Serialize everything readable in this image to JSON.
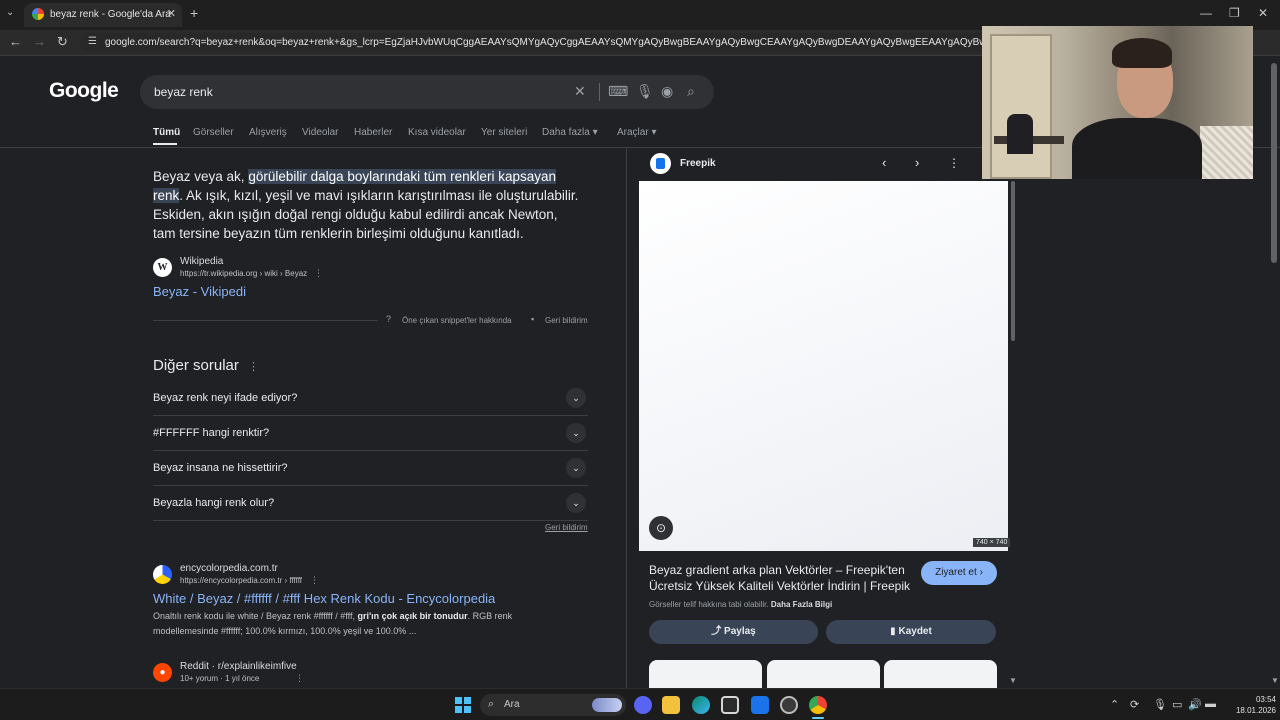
{
  "browser": {
    "tab_title": "beyaz renk - Google'da Ara",
    "new_tab_symbol": "+",
    "url": "google.com/search?q=beyaz+renk&oq=beyaz+renk+&gs_lcrp=EgZjaHJvbWUqCggAEAAYsQMYgAQyCggAEAAYsQMYgAQyBwgBEAAYgAQyBwgCEAAYgAQyBwgDEAAYgAQyBwgEEAAYgAQyBwgFEAAYgAQyBwgGEAA"
  },
  "search": {
    "logo": "Google",
    "query": "beyaz renk"
  },
  "nav": {
    "tabs": [
      "Tümü",
      "Görseller",
      "Alışveriş",
      "Videolar",
      "Haberler",
      "Kısa videolar",
      "Yer siteleri",
      "Daha fazla",
      "Araçlar"
    ]
  },
  "featured_snippet": {
    "text_before": "Beyaz veya ak, ",
    "highlight": "görülebilir dalga boylarındaki tüm renkleri kapsayan renk",
    "text_after": ". Ak ışık, kızıl, yeşil ve mavi ışıkların karıştırılması ile oluşturulabilir. Eskiden, akın ışığın doğal rengi olduğu kabul edilirdi ancak Newton, tam tersine beyazın tüm renklerin birleşimi olduğunu kanıtladı.",
    "source_icon_letter": "W",
    "source_name": "Wikipedia",
    "source_url": "https://tr.wikipedia.org › wiki › Beyaz",
    "link_text": "Beyaz - Vikipedi",
    "about_label": "Öne çıkan snippet'ler hakkında",
    "feedback_label": "Geri bildirim"
  },
  "related_questions": {
    "title": "Diğer sorular",
    "items": [
      "Beyaz renk neyi ifade ediyor?",
      "#FFFFFF hangi renktir?",
      "Beyaz insana ne hissettirir?",
      "Beyazla hangi renk olur?"
    ],
    "feedback_label": "Geri bildirim"
  },
  "results": [
    {
      "site": "encycolorpedia.com.tr",
      "url": "https://encycolorpedia.com.tr › ffffff",
      "title": "White / Beyaz / #ffffff / #fff Hex Renk Kodu - Encycolorpedia",
      "desc_before": "Onaltılı renk kodu ile white / Beyaz renk #ffffff / #fff, ",
      "desc_bold": "gri'ın çok açık bir tonudur",
      "desc_after": ". RGB renk modellemesinde #ffffff; 100.0% kırmızı, 100.0% yeşil ve 100.0% ..."
    },
    {
      "site": "Reddit · r/explainlikeimfive",
      "meta": "10+ yorum · 1 yıl önce"
    }
  ],
  "side_panel": {
    "source": "Freepik",
    "image_size": "740 × 740",
    "title": "Beyaz gradient arka plan Vektörler – Freepik'ten Ücretsiz Yüksek Kaliteli Vektörler İndirin | Freepik",
    "visit_label": "Ziyaret et",
    "copyright_text": "Görseller telif hakkına tabi olabilir.",
    "learn_more": "Daha Fazla Bilgi",
    "share_label": "Paylaş",
    "save_label": "Kaydet"
  },
  "taskbar": {
    "search_label": "Ara",
    "time": "03:54",
    "date": "18.01.2026"
  },
  "colors": {
    "background": "#202124",
    "link": "#8ab4f8",
    "highlight": "#394457",
    "accent_button": "#8ab4f8"
  }
}
